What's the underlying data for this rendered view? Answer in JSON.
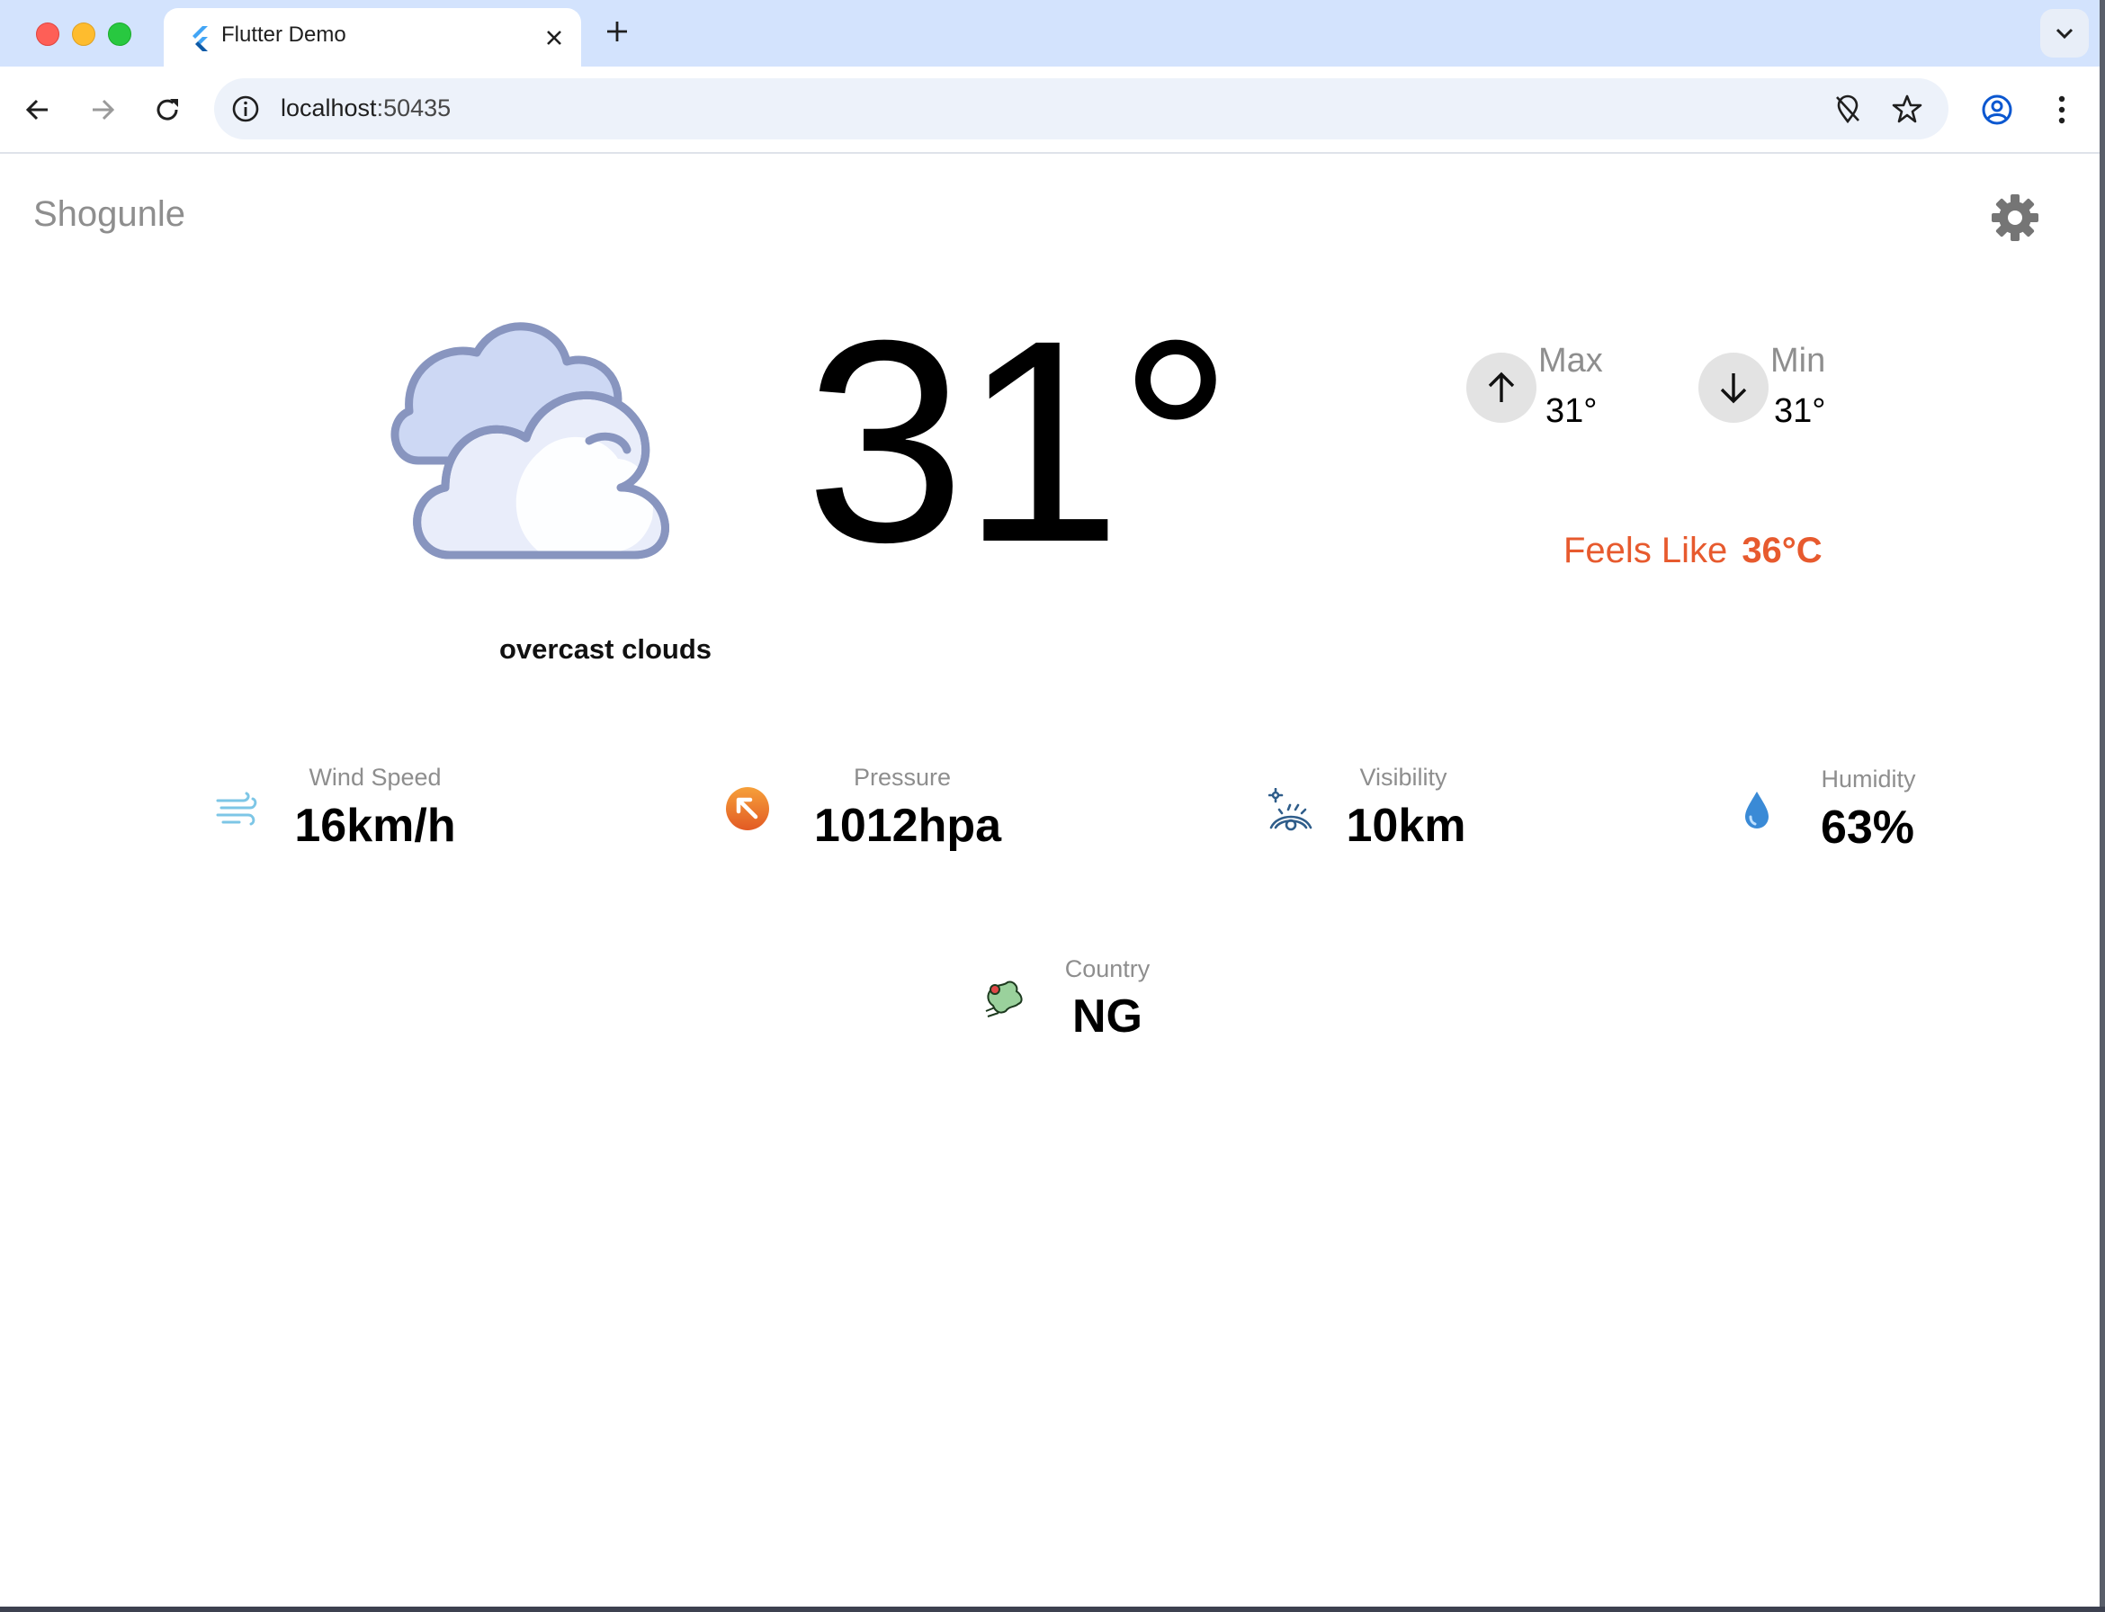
{
  "browser": {
    "tab_title": "Flutter Demo",
    "url_host": "localhost",
    "url_port": ":50435"
  },
  "app": {
    "title": "Shogunle"
  },
  "weather": {
    "temperature": "31°",
    "condition": "overcast clouds",
    "max_label": "Max",
    "max_value": "31°",
    "min_label": "Min",
    "min_value": "31°",
    "feels_like_label": "Feels Like",
    "feels_like_value": "36°C",
    "accent_color": "#e75a2e"
  },
  "stats": {
    "wind_label": "Wind Speed",
    "wind_value": "16km/h",
    "pressure_label": "Pressure",
    "pressure_value": "1012hpa",
    "visibility_label": "Visibility",
    "visibility_value": "10km",
    "humidity_label": "Humidity",
    "humidity_value": "63%",
    "country_label": "Country",
    "country_value": "NG"
  },
  "icons": {
    "weather": "overcast-clouds-icon",
    "wind": "wind-icon",
    "pressure": "pressure-arrow-icon",
    "visibility": "visibility-eye-icon",
    "humidity": "water-drop-icon",
    "country": "country-map-icon",
    "settings": "gear-icon"
  }
}
